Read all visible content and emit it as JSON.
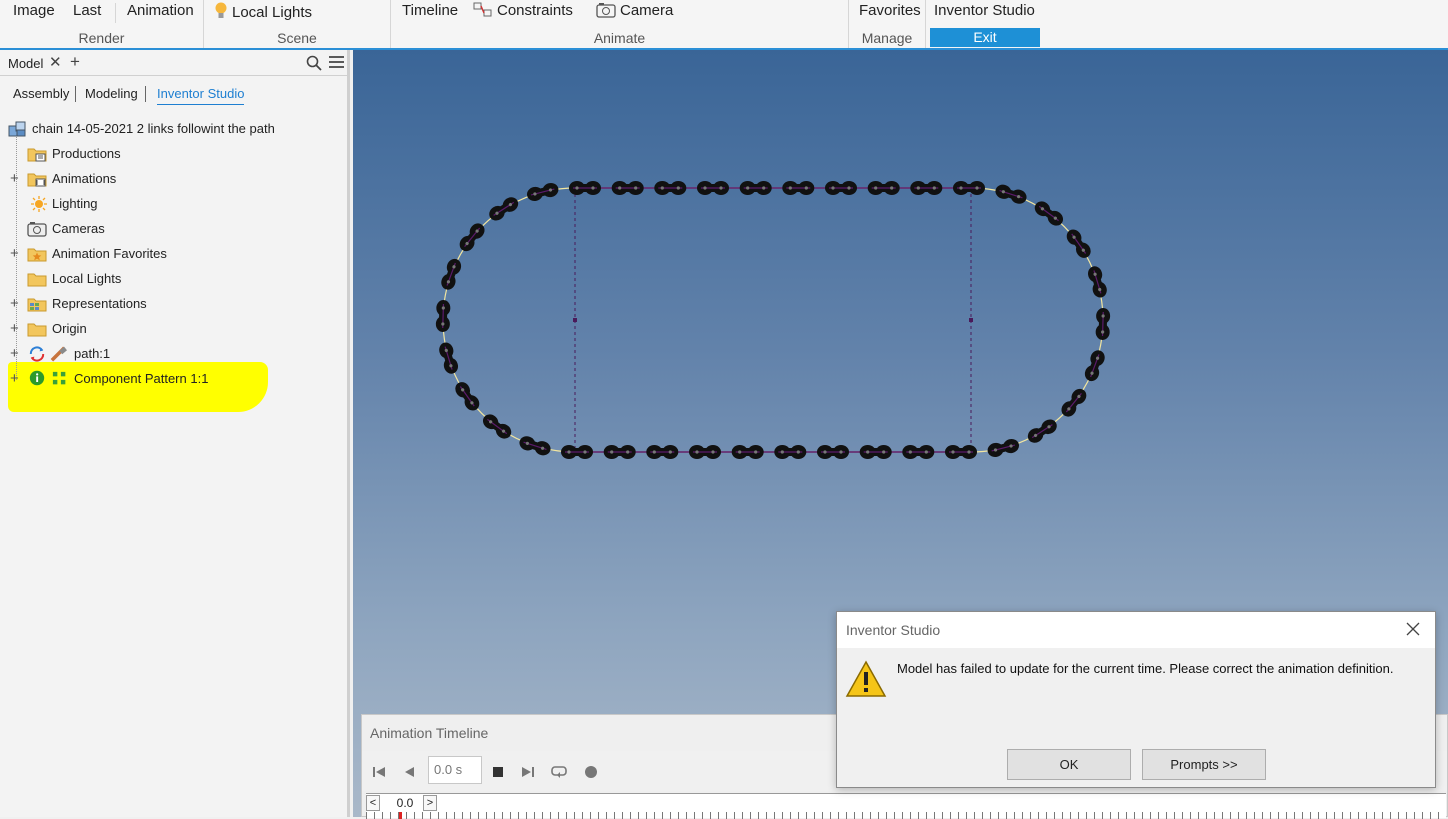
{
  "ribbon": {
    "render": {
      "image": "Image",
      "last": "Last",
      "animation": "Animation",
      "label": "Render"
    },
    "scene": {
      "local_lights": "Local Lights",
      "label": "Scene"
    },
    "animate": {
      "timeline": "Timeline",
      "constraints": "Constraints",
      "camera": "Camera",
      "label": "Animate"
    },
    "manage": {
      "favorites": "Favorites",
      "label": "Manage"
    },
    "studio": {
      "title": "Inventor Studio",
      "exit": "Exit"
    },
    "accent_color": "#1e90d6"
  },
  "browser": {
    "tab_label": "Model",
    "modes": [
      "Assembly",
      "Modeling",
      "Inventor Studio"
    ],
    "active_mode": "Inventor Studio",
    "tree": {
      "root": "chain 14-05-2021  2 links followint the path",
      "items": [
        {
          "label": "Productions",
          "icon": "folder-film-icon",
          "expandable": false
        },
        {
          "label": "Animations",
          "icon": "folder-film-icon",
          "expandable": true
        },
        {
          "label": "Lighting",
          "icon": "sun-icon",
          "expandable": false
        },
        {
          "label": "Cameras",
          "icon": "camera-icon",
          "expandable": false
        },
        {
          "label": "Animation Favorites",
          "icon": "folder-star-icon",
          "expandable": true
        },
        {
          "label": "Local Lights",
          "icon": "folder-icon",
          "expandable": false
        },
        {
          "label": "Representations",
          "icon": "folder-grid-icon",
          "expandable": true
        },
        {
          "label": "Origin",
          "icon": "folder-icon",
          "expandable": true
        },
        {
          "label": "path:1",
          "icon": "refresh-error-icon",
          "expandable": true
        },
        {
          "label": "Component Pattern 1:1",
          "icon": "info-pattern-icon",
          "expandable": true,
          "highlighted": true
        }
      ]
    },
    "highlight_color": "#ffff00"
  },
  "timeline": {
    "title": "Animation Timeline",
    "time": "0.0 s",
    "scale_value": "0.0"
  },
  "dialog": {
    "title": "Inventor Studio",
    "message": "Model has failed to update for the current time. Please correct the animation definition.",
    "ok": "OK",
    "prompts": "Prompts >>",
    "icon": "warning-icon"
  }
}
